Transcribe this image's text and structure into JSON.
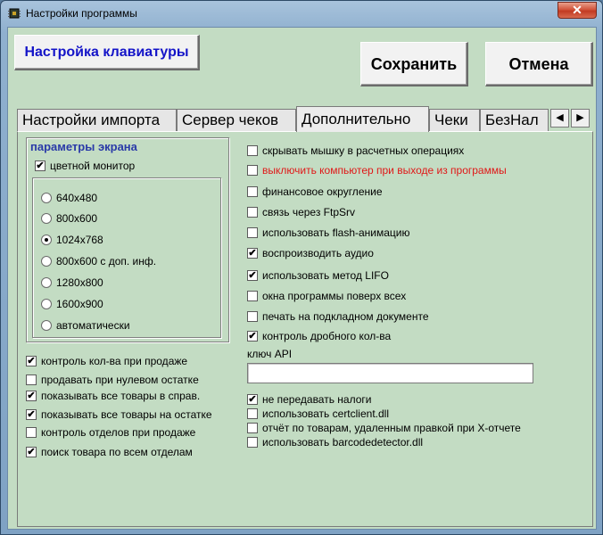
{
  "window": {
    "title": "Настройки программы",
    "close_glyph": "✕"
  },
  "toolbar": {
    "keyboard_label": "Настройка клавиатуры",
    "save_label": "Сохранить",
    "cancel_label": "Отмена"
  },
  "tabs": [
    {
      "label": "Настройки импорта",
      "active": false
    },
    {
      "label": "Сервер чеков",
      "active": false
    },
    {
      "label": "Дополнительно",
      "active": true
    },
    {
      "label": "Чеки",
      "active": false
    },
    {
      "label": "БезНал",
      "active": false
    }
  ],
  "tab_scroll": {
    "left": "◀",
    "right": "▶"
  },
  "screen_group": {
    "title": "параметры экрана",
    "color_monitor": {
      "label": "цветной монитор",
      "checked": true
    },
    "resolutions": [
      {
        "label": "640x480",
        "selected": false
      },
      {
        "label": "800x600",
        "selected": false
      },
      {
        "label": "1024x768",
        "selected": true
      },
      {
        "label": "800x600 с доп. инф.",
        "selected": false
      },
      {
        "label": "1280x800",
        "selected": false
      },
      {
        "label": "1600x900",
        "selected": false
      },
      {
        "label": "автоматически",
        "selected": false
      }
    ]
  },
  "left_options": [
    {
      "label": "контроль кол-ва при продаже",
      "checked": true
    },
    {
      "label": "продавать при нулевом остатке",
      "checked": false
    },
    {
      "label": "показывать все товары в справ.",
      "checked": true
    },
    {
      "label": "показывать все товары на остатке",
      "checked": true
    },
    {
      "label": "контроль отделов при продаже",
      "checked": false
    },
    {
      "label": "поиск товара по всем отделам",
      "checked": true
    }
  ],
  "right_options": [
    {
      "label": "скрывать мышку в расчетных операциях",
      "checked": false
    },
    {
      "label": "выключить компьютер при выходе из программы",
      "checked": false,
      "color": "#e01818"
    },
    {
      "label": "финансовое округление",
      "checked": false
    },
    {
      "label": "связь через FtpSrv",
      "checked": false
    },
    {
      "label": "использовать flash-анимацию",
      "checked": false
    },
    {
      "label": "воспроизводить аудио",
      "checked": true
    },
    {
      "label": "использовать метод LIFO",
      "checked": true
    },
    {
      "label": "окна программы поверх всех",
      "checked": false
    },
    {
      "label": "печать на подкладном документе",
      "checked": false
    },
    {
      "label": "контроль дробного кол-ва",
      "checked": true
    }
  ],
  "api_key": {
    "label": "ключ API",
    "value": ""
  },
  "bottom_options": [
    {
      "label": "не передавать налоги",
      "checked": true
    },
    {
      "label": "использовать certclient.dll",
      "checked": false
    },
    {
      "label": "отчёт по товарам, удаленным правкой при X-отчете",
      "checked": false
    },
    {
      "label": "использовать barcodedetector.dll",
      "checked": false
    }
  ]
}
